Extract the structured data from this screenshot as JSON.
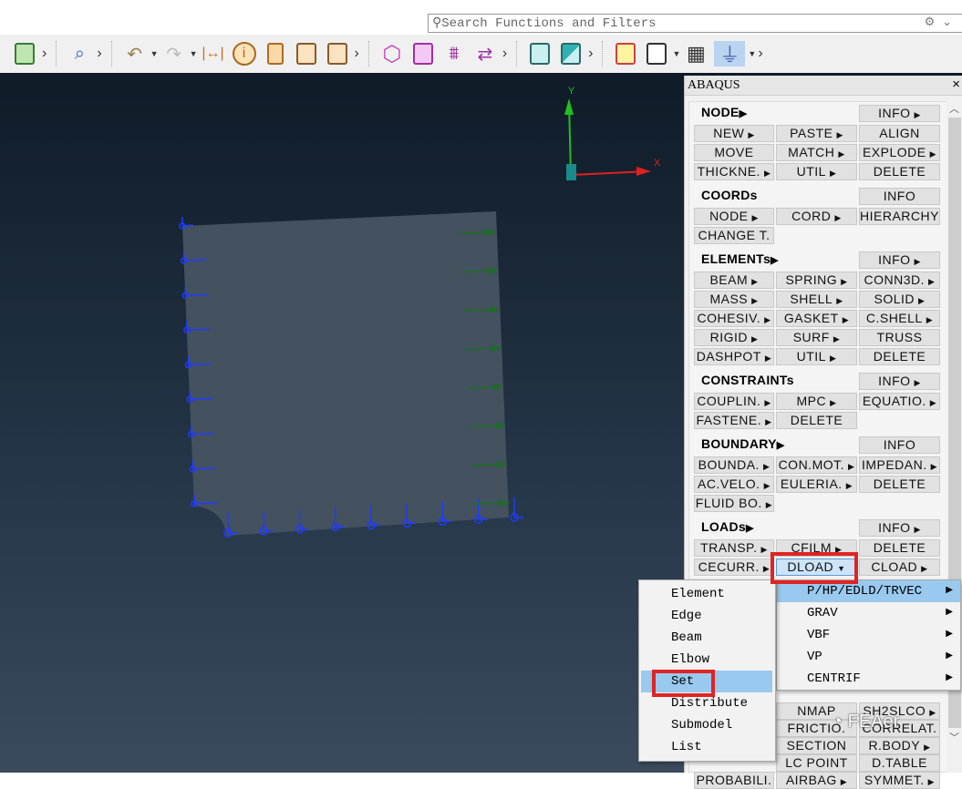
{
  "search": {
    "placeholder": "Search Functions and Filters",
    "icon": "search-icon"
  },
  "toolbar": {
    "icons": [
      "script-icon",
      "zoom-box-icon",
      "undo-icon",
      "redo-icon",
      "measure-icon",
      "info-icon",
      "delete-icon",
      "edit-table-icon",
      "check-table-icon",
      "hexagon-icon",
      "frame-icon",
      "split-icon",
      "swap-icon",
      "notes-icon",
      "display-icon",
      "yellow-frame-icon",
      "grid-icon",
      "mesh-icon",
      "probe-icon"
    ]
  },
  "viewport": {
    "axes": {
      "y": "Y",
      "x": "X"
    },
    "colors": {
      "plate": "#44515f",
      "constraint": "#1e3cff",
      "load": "#1f6b2a",
      "x_axis": "#e02020",
      "y_axis": "#20c020"
    }
  },
  "panel": {
    "title": "ABAQUS",
    "close": "×",
    "sections": [
      {
        "title": "NODE",
        "arrow": true,
        "info": {
          "label": "INFO",
          "arrow": true
        },
        "rows": [
          [
            [
              "NEW",
              1
            ],
            [
              "PASTE",
              1
            ],
            [
              "ALIGN",
              0
            ]
          ],
          [
            [
              "MOVE",
              0
            ],
            [
              "MATCH",
              1
            ],
            [
              "EXPLODE",
              1
            ]
          ],
          [
            [
              "THICKNE.",
              1
            ],
            [
              "UTIL",
              1
            ],
            [
              "DELETE",
              0
            ]
          ]
        ]
      },
      {
        "title": "COORDs",
        "arrow": false,
        "info": {
          "label": "INFO",
          "arrow": false
        },
        "rows": [
          [
            [
              "NODE",
              1
            ],
            [
              "CORD",
              1
            ],
            [
              "HIERARCHY",
              0
            ]
          ],
          [
            [
              "CHANGE T.",
              0
            ]
          ]
        ]
      },
      {
        "title": "ELEMENTs",
        "arrow": true,
        "info": {
          "label": "INFO",
          "arrow": true
        },
        "rows": [
          [
            [
              "BEAM",
              1
            ],
            [
              "SPRING",
              1
            ],
            [
              "CONN3D.",
              1
            ]
          ],
          [
            [
              "MASS",
              1
            ],
            [
              "SHELL",
              1
            ],
            [
              "SOLID",
              1
            ]
          ],
          [
            [
              "COHESIV.",
              1
            ],
            [
              "GASKET",
              1
            ],
            [
              "C.SHELL",
              1
            ]
          ],
          [
            [
              "RIGID",
              1
            ],
            [
              "SURF",
              1
            ],
            [
              "TRUSS",
              0
            ]
          ],
          [
            [
              "DASHPOT",
              1
            ],
            [
              "UTIL",
              1
            ],
            [
              "DELETE",
              0
            ]
          ]
        ]
      },
      {
        "title": "CONSTRAINTs",
        "arrow": false,
        "info": {
          "label": "INFO",
          "arrow": true
        },
        "rows": [
          [
            [
              "COUPLIN.",
              1
            ],
            [
              "MPC",
              1
            ],
            [
              "EQUATIO.",
              1
            ]
          ],
          [
            [
              "FASTENE.",
              1
            ],
            [
              "DELETE",
              0
            ]
          ]
        ]
      },
      {
        "title": "BOUNDARY",
        "arrow": true,
        "info": {
          "label": "INFO",
          "arrow": false
        },
        "rows": [
          [
            [
              "BOUNDA.",
              1
            ],
            [
              "CON.MOT.",
              1
            ],
            [
              "IMPEDAN.",
              1
            ]
          ],
          [
            [
              "AC.VELO.",
              1
            ],
            [
              "EULERIA.",
              1
            ],
            [
              "DELETE",
              0
            ]
          ],
          [
            [
              "FLUID BO.",
              1
            ]
          ]
        ]
      },
      {
        "title": "LOADs",
        "arrow": true,
        "info": {
          "label": "INFO",
          "arrow": true
        },
        "rows": [
          [
            [
              "TRANSP.",
              1
            ],
            [
              "CFILM",
              1
            ],
            [
              "DELETE",
              0
            ]
          ],
          [
            [
              "CECURR.",
              1
            ],
            [
              "DLOAD",
              2
            ],
            [
              "CLOAD",
              1
            ]
          ]
        ]
      }
    ],
    "lower_rows": [
      [
        null,
        [
          "NMAP",
          0
        ],
        [
          "SH2SLCO",
          1
        ]
      ],
      [
        null,
        [
          "FRICTIO.",
          0
        ],
        [
          "CORRELAT.",
          0
        ]
      ],
      [
        null,
        [
          "SECTION",
          0
        ],
        [
          "R.BODY",
          1
        ]
      ],
      [
        null,
        [
          "LC POINT",
          0
        ],
        [
          "D.TABLE",
          0
        ]
      ],
      [
        [
          "PROBABILI.",
          0
        ],
        [
          "AIRBAG",
          1
        ],
        [
          "SYMMET.",
          1
        ]
      ]
    ]
  },
  "dload_menu": {
    "items": [
      {
        "label": "P/HP/EDLD/TRVEC",
        "highlighted": true
      },
      {
        "label": "GRAV"
      },
      {
        "label": "VBF"
      },
      {
        "label": "VP"
      },
      {
        "label": "CENTRIF"
      }
    ]
  },
  "sub_menu": {
    "items": [
      {
        "label": "Element"
      },
      {
        "label": "Edge"
      },
      {
        "label": "Beam"
      },
      {
        "label": "Elbow"
      },
      {
        "label": "Set",
        "highlighted": true
      },
      {
        "label": "Distribute"
      },
      {
        "label": "Submodel"
      },
      {
        "label": "List"
      }
    ]
  },
  "watermark": "FEAer",
  "highlight_color": "#e02424"
}
